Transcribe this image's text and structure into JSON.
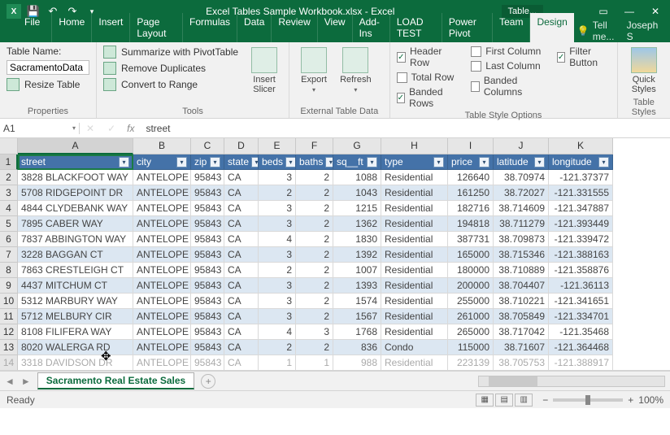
{
  "title": "Excel Tables Sample Workbook.xlsx - Excel",
  "tabletools": "Table...",
  "ribbon_tabs": [
    "File",
    "Home",
    "Insert",
    "Page Layout",
    "Formulas",
    "Data",
    "Review",
    "View",
    "Add-Ins",
    "LOAD TEST",
    "Power Pivot",
    "Team",
    "Design"
  ],
  "active_tab": "Design",
  "tellme": "Tell me...",
  "user": "Joseph S",
  "properties": {
    "label": "Properties",
    "table_name_label": "Table Name:",
    "table_name": "SacramentoData",
    "resize": "Resize Table"
  },
  "tools": {
    "label": "Tools",
    "pivot": "Summarize with PivotTable",
    "dup": "Remove Duplicates",
    "convert": "Convert to Range",
    "slicer": "Insert\nSlicer"
  },
  "external": {
    "label": "External Table Data",
    "export": "Export",
    "refresh": "Refresh"
  },
  "styleopts": {
    "label": "Table Style Options",
    "header_row": "Header Row",
    "total_row": "Total Row",
    "banded_rows": "Banded Rows",
    "first_col": "First Column",
    "last_col": "Last Column",
    "banded_cols": "Banded Columns",
    "filter_btn": "Filter Button"
  },
  "tablestyles": {
    "label": "Table Styles",
    "quick": "Quick\nStyles"
  },
  "namebox": "A1",
  "formula": "street",
  "columns": [
    "A",
    "B",
    "C",
    "D",
    "E",
    "F",
    "G",
    "H",
    "I",
    "J",
    "K"
  ],
  "headers": [
    "street",
    "city",
    "zip",
    "state",
    "beds",
    "baths",
    "sq__ft",
    "type",
    "price",
    "latitude",
    "longitude"
  ],
  "numcols": [
    2,
    4,
    5,
    6,
    8,
    9,
    10
  ],
  "rows": [
    [
      "3828 BLACKFOOT WAY",
      "ANTELOPE",
      "95843",
      "CA",
      "3",
      "2",
      "1088",
      "Residential",
      "126640",
      "38.70974",
      "-121.37377"
    ],
    [
      "5708 RIDGEPOINT DR",
      "ANTELOPE",
      "95843",
      "CA",
      "2",
      "2",
      "1043",
      "Residential",
      "161250",
      "38.72027",
      "-121.331555"
    ],
    [
      "4844 CLYDEBANK WAY",
      "ANTELOPE",
      "95843",
      "CA",
      "3",
      "2",
      "1215",
      "Residential",
      "182716",
      "38.714609",
      "-121.347887"
    ],
    [
      "7895 CABER WAY",
      "ANTELOPE",
      "95843",
      "CA",
      "3",
      "2",
      "1362",
      "Residential",
      "194818",
      "38.711279",
      "-121.393449"
    ],
    [
      "7837 ABBINGTON WAY",
      "ANTELOPE",
      "95843",
      "CA",
      "4",
      "2",
      "1830",
      "Residential",
      "387731",
      "38.709873",
      "-121.339472"
    ],
    [
      "3228 BAGGAN CT",
      "ANTELOPE",
      "95843",
      "CA",
      "3",
      "2",
      "1392",
      "Residential",
      "165000",
      "38.715346",
      "-121.388163"
    ],
    [
      "7863 CRESTLEIGH CT",
      "ANTELOPE",
      "95843",
      "CA",
      "2",
      "2",
      "1007",
      "Residential",
      "180000",
      "38.710889",
      "-121.358876"
    ],
    [
      "4437 MITCHUM CT",
      "ANTELOPE",
      "95843",
      "CA",
      "3",
      "2",
      "1393",
      "Residential",
      "200000",
      "38.704407",
      "-121.36113"
    ],
    [
      "5312 MARBURY WAY",
      "ANTELOPE",
      "95843",
      "CA",
      "3",
      "2",
      "1574",
      "Residential",
      "255000",
      "38.710221",
      "-121.341651"
    ],
    [
      "5712 MELBURY CIR",
      "ANTELOPE",
      "95843",
      "CA",
      "3",
      "2",
      "1567",
      "Residential",
      "261000",
      "38.705849",
      "-121.334701"
    ],
    [
      "8108 FILIFERA WAY",
      "ANTELOPE",
      "95843",
      "CA",
      "4",
      "3",
      "1768",
      "Residential",
      "265000",
      "38.717042",
      "-121.35468"
    ],
    [
      "8020 WALERGA RD",
      "ANTELOPE",
      "95843",
      "CA",
      "2",
      "2",
      "836",
      "Condo",
      "115000",
      "38.71607",
      "-121.364468"
    ],
    [
      "3318 DAVIDSON DR",
      "ANTELOPE",
      "95843",
      "CA",
      "1",
      "1",
      "988",
      "Residential",
      "223139",
      "38.705753",
      "-121.388917"
    ]
  ],
  "sheet_tab": "Sacramento Real Estate Sales",
  "status": "Ready",
  "zoom": "100%"
}
